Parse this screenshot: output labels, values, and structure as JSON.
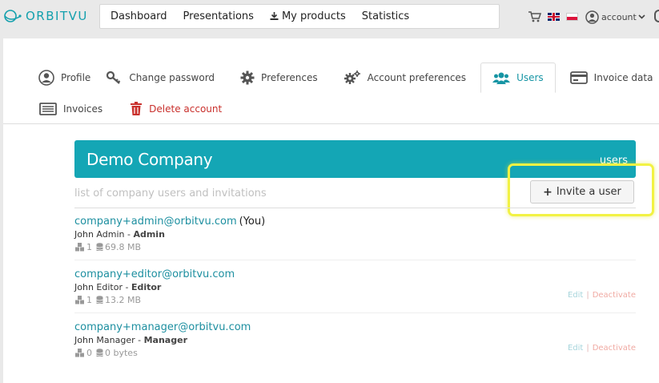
{
  "brand": {
    "name": "ORBITVU",
    "color": "#14a0ad"
  },
  "nav": {
    "items": [
      "Dashboard",
      "Presentations",
      "My products",
      "Statistics"
    ]
  },
  "header": {
    "account_label": "account"
  },
  "tabs": {
    "profile": "Profile",
    "change_password": "Change password",
    "preferences": "Preferences",
    "account_preferences": "Account preferences",
    "users": "Users",
    "invoice_data": "Invoice data",
    "invoices": "Invoices",
    "delete_account": "Delete account"
  },
  "company": {
    "name": "Demo Company",
    "section": "users",
    "subtitle": "list of company users and invitations",
    "invite_label": "Invite a user",
    "bar_color": "#14a6b5"
  },
  "users": [
    {
      "email": "company+admin@orbitvu.com",
      "you": "(You)",
      "name": "John Admin",
      "role": "Admin",
      "presentations": "1",
      "storage": "69.8 MB"
    },
    {
      "email": "company+editor@orbitvu.com",
      "name": "John Editor",
      "role": "Editor",
      "presentations": "1",
      "storage": "13.2 MB",
      "edit": "Edit",
      "deactivate": "Deactivate"
    },
    {
      "email": "company+manager@orbitvu.com",
      "name": "John Manager",
      "role": "Manager",
      "presentations": "0",
      "storage": "0 bytes",
      "edit": "Edit",
      "deactivate": "Deactivate"
    }
  ],
  "role_separator": " - "
}
